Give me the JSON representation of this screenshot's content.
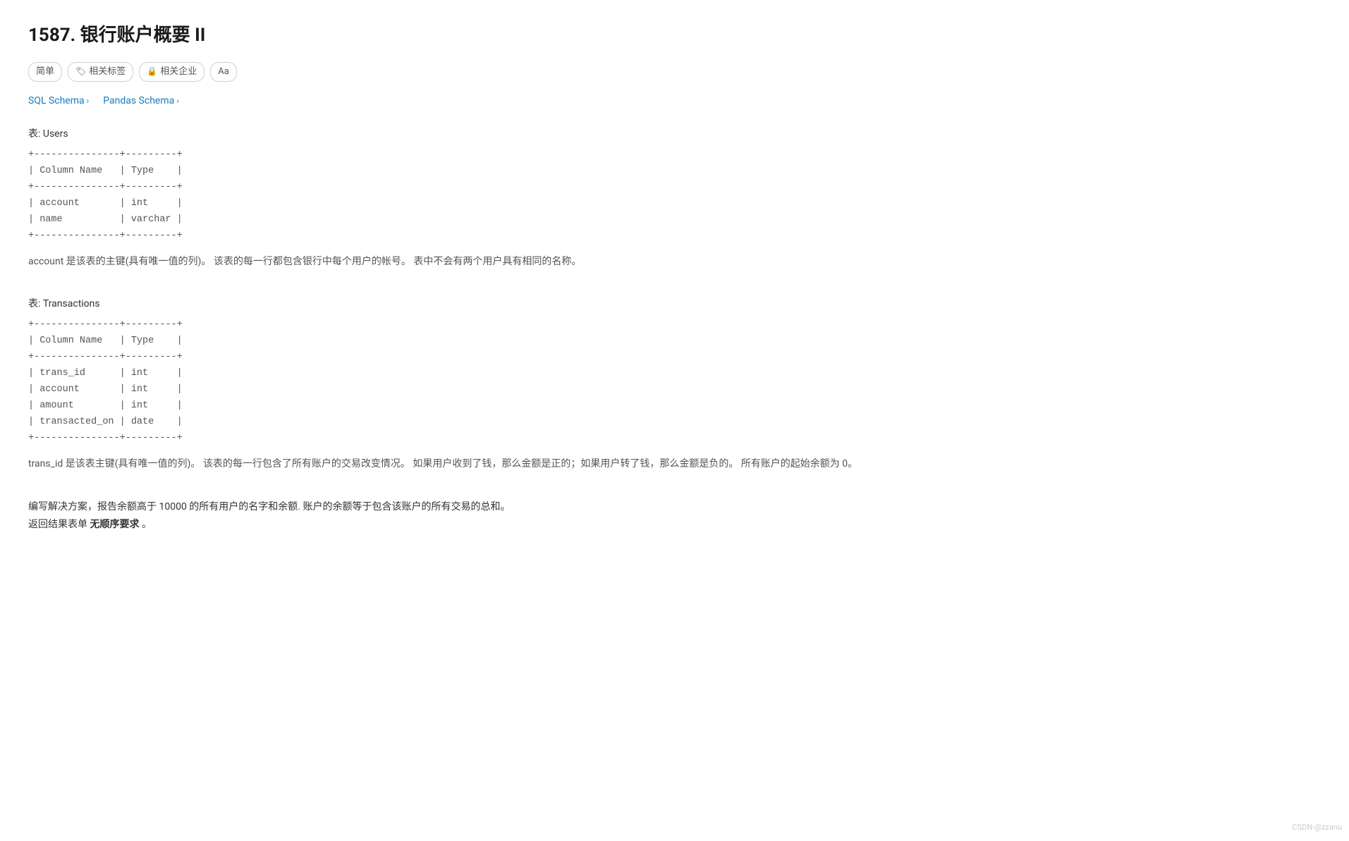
{
  "page": {
    "title": "1587. 银行账户概要 II",
    "tags": [
      {
        "label": "简单",
        "icon": ""
      },
      {
        "label": "相关标签",
        "icon": "🏷"
      },
      {
        "label": "相关企业",
        "icon": "🔒"
      },
      {
        "label": "Aa",
        "icon": ""
      }
    ],
    "schema_links": [
      {
        "label": "SQL Schema",
        "href": "#"
      },
      {
        "label": "Pandas Schema",
        "href": "#"
      }
    ],
    "users_table_label": "表: Users",
    "users_schema": "+---------------+---------+\n| Column Name   | Type    |\n+---------------+---------+\n| account       | int     |\n| name          | varchar |\n+---------------+---------+",
    "users_description": "account 是该表的主键(具有唯一值的列)。\n该表的每一行都包含银行中每个用户的帐号。\n表中不会有两个用户具有相同的名称。",
    "transactions_table_label": "表: Transactions",
    "transactions_schema": "+---------------+---------+\n| Column Name   | Type    |\n+---------------+---------+\n| trans_id      | int     |\n| account       | int     |\n| amount        | int     |\n| transacted_on | date    |\n+---------------+---------+",
    "transactions_description": "trans_id 是该表主键(具有唯一值的列)。\n该表的每一行包含了所有账户的交易改变情况。\n如果用户收到了钱，那么金额是正的；如果用户转了钱，那么金额是负的。\n所有账户的起始余额为 0。",
    "task_description": "编写解决方案，报告余额高于 10000 的所有用户的名字和余额. 账户的余额等于包含该账户的所有交易的总和。",
    "task_return": "返回结果表单",
    "task_return_bold": "无顺序要求",
    "task_return_end": "。",
    "watermark": "CSDN-@zzanu"
  }
}
